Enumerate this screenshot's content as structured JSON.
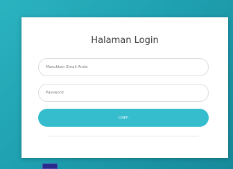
{
  "login": {
    "title": "Halaman Login",
    "email_placeholder": "Masukkan Email Anda",
    "password_placeholder": "Password",
    "button_label": "Login"
  },
  "colors": {
    "background": "#1fa0b0",
    "card": "#ffffff",
    "accent_button": "#35bccd",
    "title_text": "#3b3b3b"
  },
  "icons": {
    "taskbar_icon": "app-tile-icon"
  }
}
